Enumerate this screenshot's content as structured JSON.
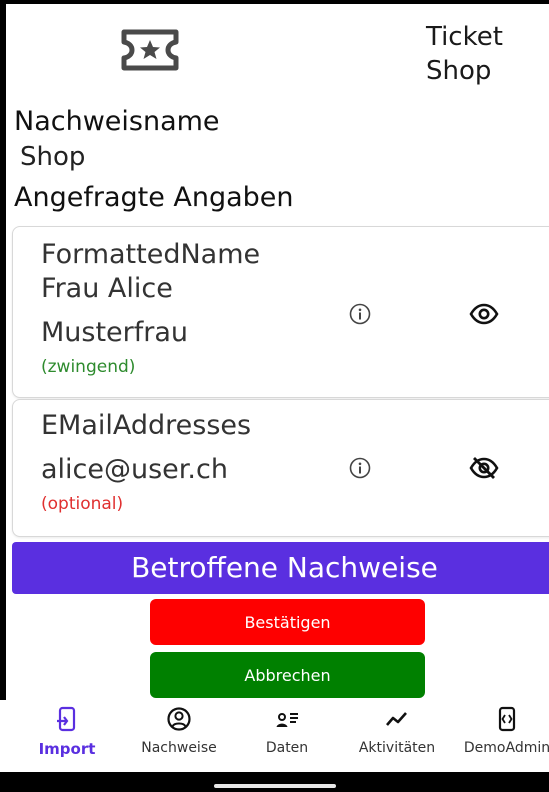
{
  "header": {
    "shop_title": "Ticket Shop",
    "icon": "ticket-icon"
  },
  "credential": {
    "name_label": "Nachweisname",
    "name_value": "Shop",
    "requested_title": "Angefragte Angaben"
  },
  "attributes": [
    {
      "name": "FormattedName",
      "value_line1": "Frau Alice",
      "value_line2": "Musterfrau",
      "flag": "(zwingend)",
      "visibility_icon": "eye-icon"
    },
    {
      "name": "EMailAddresses",
      "value_line1": "alice@user.ch",
      "flag": "(optional)",
      "visibility_icon": "eye-off-icon"
    }
  ],
  "related_bar": "Betroffene Nachweise",
  "buttons": {
    "confirm": "Bestätigen",
    "cancel": "Abbrechen"
  },
  "tabs": [
    {
      "label": "Import",
      "icon": "import-phone-icon",
      "active": true
    },
    {
      "label": "Nachweise",
      "icon": "person-circle-icon",
      "active": false
    },
    {
      "label": "Daten",
      "icon": "person-list-icon",
      "active": false
    },
    {
      "label": "Aktivitäten",
      "icon": "activity-chart-icon",
      "active": false
    },
    {
      "label": "DemoAdmin",
      "icon": "code-phone-icon",
      "active": false
    }
  ],
  "colors": {
    "accent": "#5a2fe0",
    "confirm": "#fe0000",
    "cancel": "#008000",
    "required": "#2e8b2e",
    "optional": "#e03030"
  }
}
